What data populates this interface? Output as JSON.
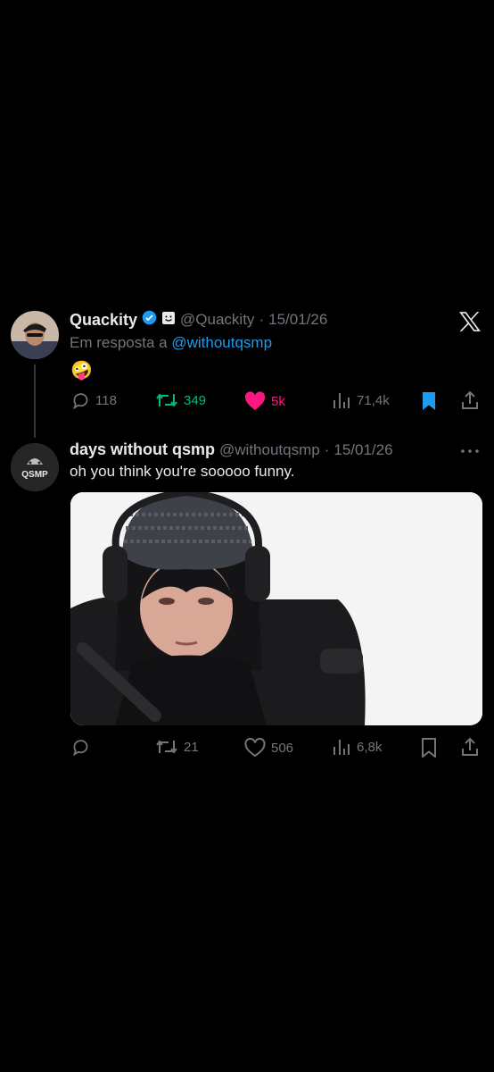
{
  "tweet1": {
    "name": "Quackity",
    "handle": "@Quackity",
    "date": "15/01/26",
    "reply_prefix": "Em resposta a",
    "reply_to": "@withoutqsmp",
    "text": "🤪",
    "actions": {
      "replies": "118",
      "retweets": "349",
      "likes": "5k",
      "views": "71,4k"
    },
    "colors": {
      "retweet": "#00ba7c",
      "like": "#f91880",
      "bookmark": "#1d9bf0"
    }
  },
  "tweet2": {
    "name": "days without qsmp",
    "handle": "@withoutqsmp",
    "date": "15/01/26",
    "text": "oh you think you're sooooo funny.",
    "avatar_logo": "QSMP",
    "actions": {
      "replies": "",
      "retweets": "21",
      "likes": "506",
      "views": "6,8k"
    }
  },
  "icons": [
    "verified-badge-icon",
    "affiliate-badge-icon",
    "x-logo-icon",
    "more-icon",
    "reply-icon",
    "retweet-icon",
    "like-icon",
    "views-icon",
    "bookmark-icon",
    "share-icon"
  ]
}
